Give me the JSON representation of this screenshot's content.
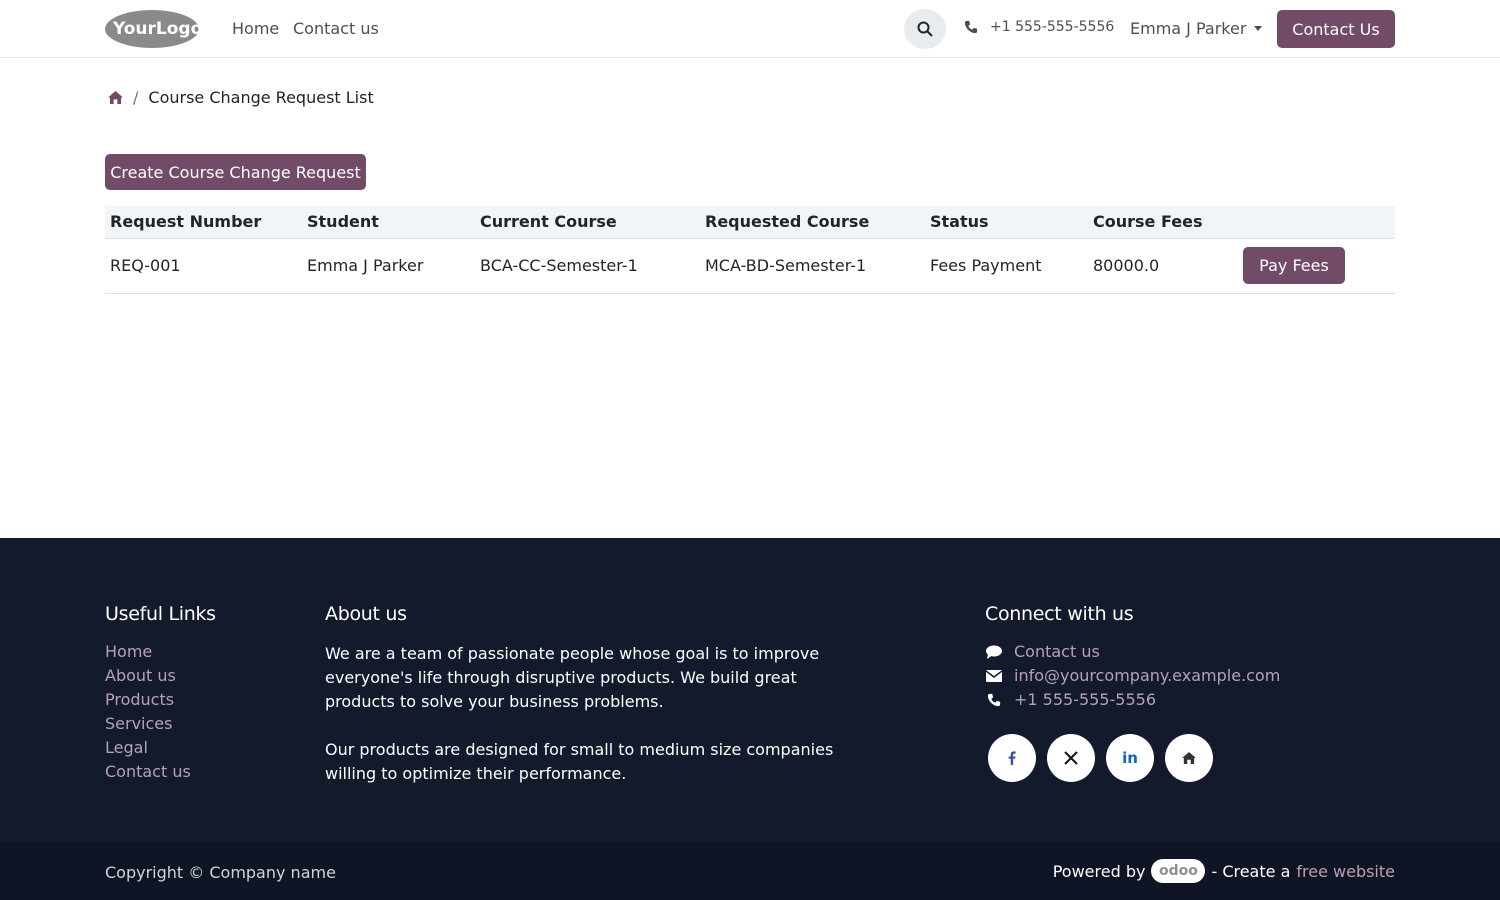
{
  "header": {
    "logo_text": "YourLogo",
    "nav": [
      "Home",
      "Contact us"
    ],
    "phone": "+1 555-555-5556",
    "user_name": "Emma J Parker",
    "contact_button": "Contact Us"
  },
  "breadcrumb": {
    "current": "Course Change Request List"
  },
  "create_button": "Create Course Change Request",
  "table": {
    "columns": [
      "Request Number",
      "Student",
      "Current Course",
      "Requested Course",
      "Status",
      "Course Fees",
      ""
    ],
    "rows": [
      {
        "request_number": "REQ-001",
        "student": "Emma J Parker",
        "current_course": "BCA-CC-Semester-1",
        "requested_course": "MCA-BD-Semester-1",
        "status": "Fees Payment",
        "course_fees": "80000.0",
        "action": "Pay Fees"
      }
    ]
  },
  "footer": {
    "useful_links_title": "Useful Links",
    "useful_links": [
      "Home",
      "About us",
      "Products",
      "Services",
      "Legal",
      "Contact us"
    ],
    "about_title": "About us",
    "about_p1": "We are a team of passionate people whose goal is to improve everyone's life through disruptive products. We build great products to solve your business problems.",
    "about_p2": "Our products are designed for small to medium size companies willing to optimize their performance.",
    "connect_title": "Connect with us",
    "connect_items": [
      "Contact us",
      "info@yourcompany.example.com",
      "+1 555-555-5556"
    ],
    "socials": [
      "facebook-icon",
      "x-icon",
      "linkedin-icon",
      "home-icon"
    ]
  },
  "bottom": {
    "copyright": "Copyright © Company name",
    "powered_by": "Powered by",
    "odoo": "odoo",
    "create_a": "- Create a",
    "free_website": "free website"
  },
  "colors": {
    "primary": "#714b67",
    "footer_bg": "#131a2c",
    "footer_link": "#b8a0b3"
  }
}
